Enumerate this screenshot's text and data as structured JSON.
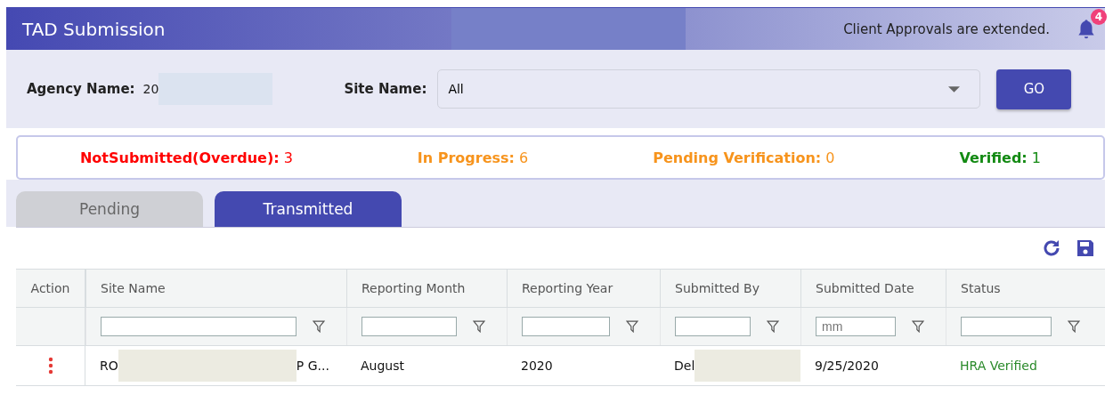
{
  "header": {
    "title": "TAD Submission",
    "notice": "Client Approvals are extended.",
    "notification_count": "4"
  },
  "filters": {
    "agency_label": "Agency Name:",
    "agency_value": "20",
    "site_label": "Site Name:",
    "site_value": "All",
    "go_button": "GO"
  },
  "summary": [
    {
      "label": "NotSubmitted(Overdue):",
      "count": "3",
      "color": "#ff0000"
    },
    {
      "label": "In Progress:",
      "count": "6",
      "color": "#f7941d"
    },
    {
      "label": "Pending Verification:",
      "count": "0",
      "color": "#f7941d"
    },
    {
      "label": "Verified:",
      "count": "1",
      "color": "#138a13"
    }
  ],
  "tabs": [
    {
      "label": "Pending",
      "selected": false
    },
    {
      "label": "Transmitted",
      "selected": true
    }
  ],
  "table": {
    "columns": [
      {
        "label": "Action",
        "filter": false
      },
      {
        "label": "Site Name",
        "filter": true
      },
      {
        "label": "Reporting Month",
        "filter": true
      },
      {
        "label": "Reporting Year",
        "filter": true
      },
      {
        "label": "Submitted By",
        "filter": true
      },
      {
        "label": "Submitted Date",
        "filter": true,
        "placeholder": "mm"
      },
      {
        "label": "Status",
        "filter": true
      }
    ],
    "rows": [
      {
        "site_name_start": "RO",
        "site_name_end": "P G...",
        "reporting_month": "August",
        "reporting_year": "2020",
        "submitted_by": "Del",
        "submitted_date": "9/25/2020",
        "status": "HRA Verified"
      }
    ]
  }
}
